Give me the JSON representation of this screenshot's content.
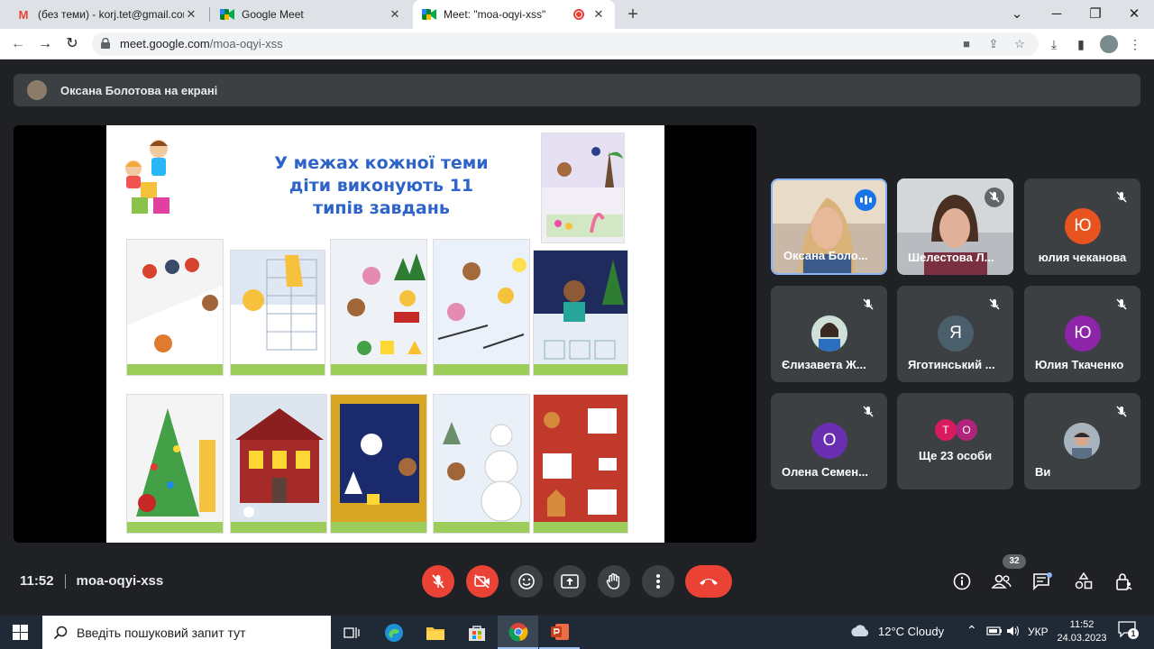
{
  "browser": {
    "tabs": [
      {
        "title": "(без теми) - korj.tet@gmail.com",
        "favicon": "gmail-icon"
      },
      {
        "title": "Google Meet",
        "favicon": "meet-icon"
      },
      {
        "title": "Meet: \"moa-oqyi-xss\"",
        "favicon": "meet-icon",
        "recording": true
      }
    ],
    "url_host": "meet.google.com",
    "url_path": "/moa-oqyi-xss"
  },
  "meet": {
    "presenter_banner": "Оксана Болотова на екрані",
    "slide": {
      "title_line1": "У межах кожної теми",
      "title_line2": "діти виконують 11",
      "title_line3": "типів завдань"
    },
    "participants": [
      {
        "name": "Оксана Боло...",
        "kind": "video",
        "speaking": true
      },
      {
        "name": "Шелестова Л...",
        "kind": "video",
        "muted": true
      },
      {
        "name": "юлия чеканова",
        "kind": "letter",
        "letter": "Ю",
        "color": "#e8541f",
        "muted": true
      },
      {
        "name": "Єлизавета Ж...",
        "kind": "photo",
        "muted": true
      },
      {
        "name": "Яготинський ...",
        "kind": "letter",
        "letter": "Я",
        "color": "#4a5e6b",
        "muted": true
      },
      {
        "name": "Юлия Ткаченко",
        "kind": "letter",
        "letter": "Ю",
        "color": "#8e24aa",
        "muted": true
      },
      {
        "name": "Олена Семен...",
        "kind": "letter",
        "letter": "О",
        "color": "#6a2fb0",
        "muted": true
      },
      {
        "name": "Ще 23 особи",
        "kind": "group",
        "letters": [
          "Т",
          "О"
        ],
        "colors": [
          "#d81b60",
          "#b0257a"
        ]
      },
      {
        "name": "Ви",
        "kind": "photo",
        "muted": true
      }
    ],
    "time": "11:52",
    "meeting_code": "moa-oqyi-xss",
    "people_count": "32"
  },
  "taskbar": {
    "search_placeholder": "Введіть пошуковий запит тут",
    "weather": "12°C  Cloudy",
    "language": "УКР",
    "time": "11:52",
    "date": "24.03.2023",
    "notifications": "1"
  }
}
